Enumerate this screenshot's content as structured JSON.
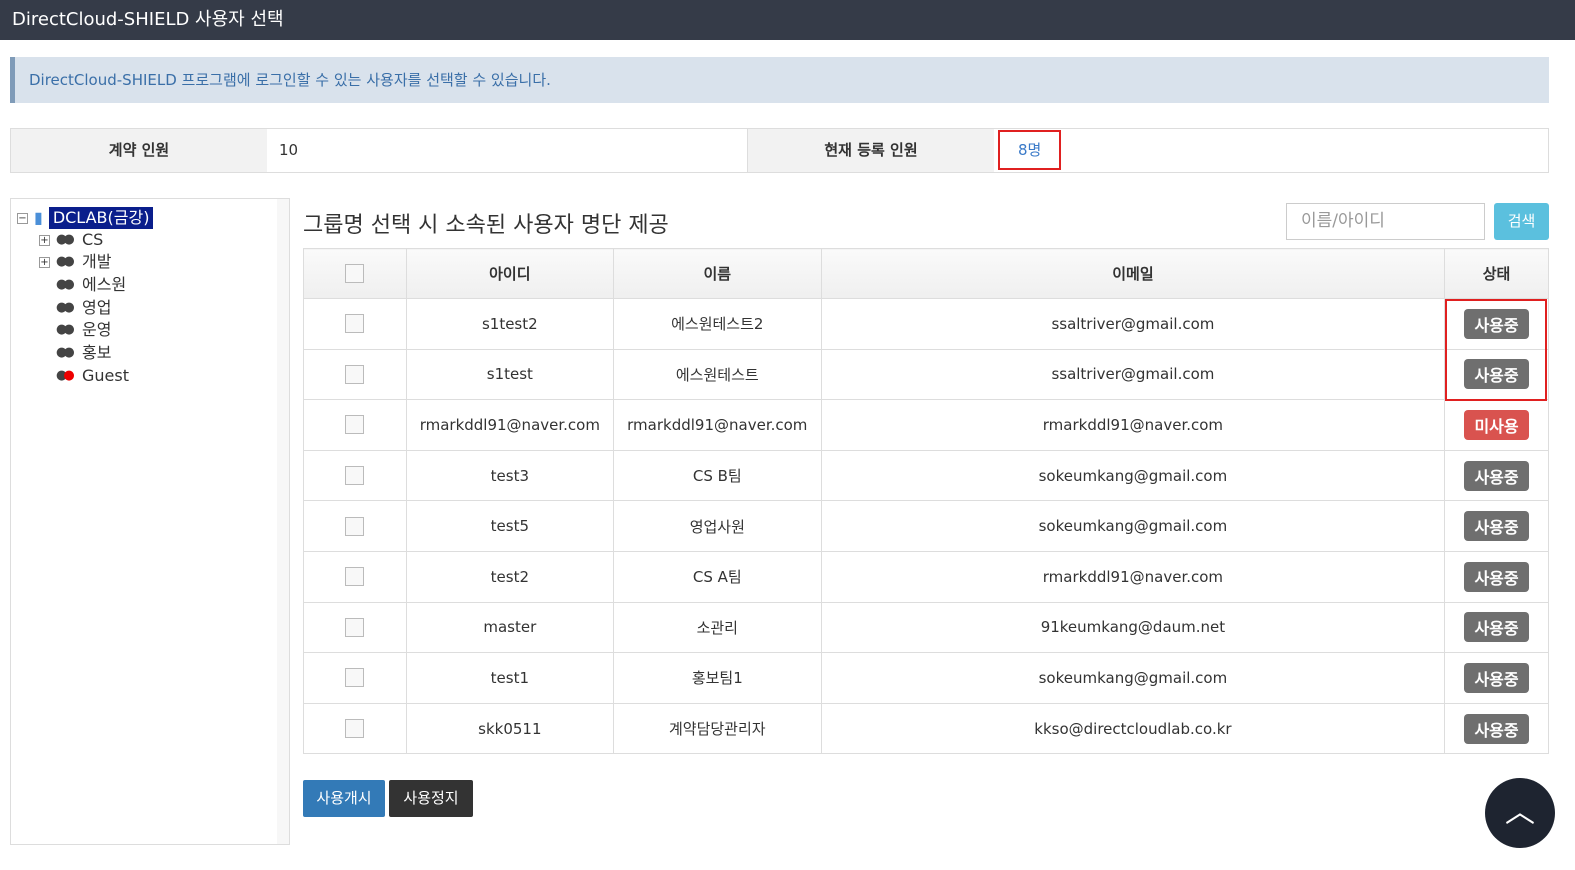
{
  "header": {
    "title": "DirectCloud-SHIELD 사용자 선택"
  },
  "info": "DirectCloud-SHIELD 프로그램에 로그인할 수 있는 사용자를 선택할 수 있습니다.",
  "contract": {
    "label": "계약 인원",
    "value": "10",
    "current_label": "현재 등록 인원",
    "current_value": "8명"
  },
  "tree": {
    "root": "DCLAB(금강)",
    "items": [
      "CS",
      "개발",
      "에스원",
      "영업",
      "운영",
      "홍보",
      "Guest"
    ]
  },
  "main": {
    "title": "그룹명 선택 시 소속된 사용자 명단 제공",
    "search_placeholder": "이름/아이디",
    "search_button": "검색",
    "columns": [
      "아이디",
      "이름",
      "이메일",
      "상태"
    ],
    "rows": [
      {
        "id": "s1test2",
        "name": "에스원테스트2",
        "email": "ssaltriver@gmail.com",
        "status": "사용중"
      },
      {
        "id": "s1test",
        "name": "에스원테스트",
        "email": "ssaltriver@gmail.com",
        "status": "사용중"
      },
      {
        "id": "rmarkddl91@naver.com",
        "name": "rmarkddl91@naver.com",
        "email": "rmarkddl91@naver.com",
        "status": "미사용"
      },
      {
        "id": "test3",
        "name": "CS B팀",
        "email": "sokeumkang@gmail.com",
        "status": "사용중"
      },
      {
        "id": "test5",
        "name": "영업사원",
        "email": "sokeumkang@gmail.com",
        "status": "사용중"
      },
      {
        "id": "test2",
        "name": "CS A팀",
        "email": "rmarkddl91@naver.com",
        "status": "사용중"
      },
      {
        "id": "master",
        "name": "소관리",
        "email": "91keumkang@daum.net",
        "status": "사용중"
      },
      {
        "id": "test1",
        "name": "홍보팀1",
        "email": "sokeumkang@gmail.com",
        "status": "사용중"
      },
      {
        "id": "skk0511",
        "name": "계약담당관리자",
        "email": "kkso@directcloudlab.co.kr",
        "status": "사용중"
      }
    ],
    "start_button": "사용개시",
    "stop_button": "사용정지"
  }
}
